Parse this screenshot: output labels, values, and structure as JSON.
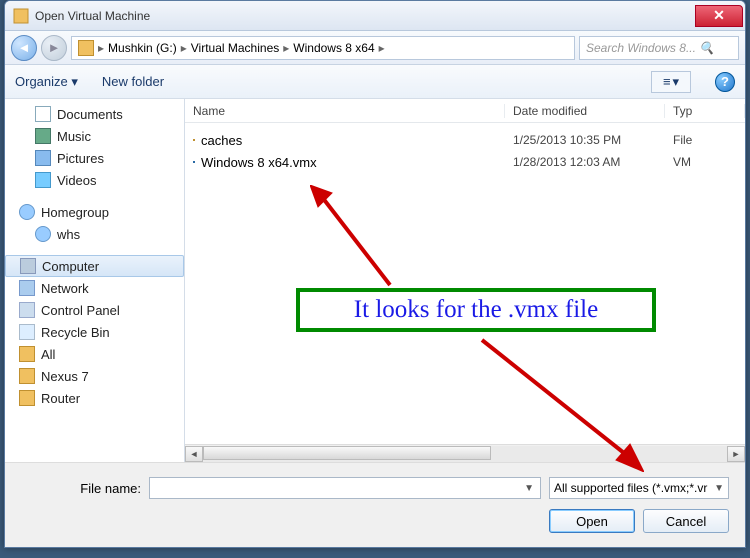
{
  "title": "Open Virtual Machine",
  "breadcrumb": {
    "drive": "Mushkin (G:)",
    "folder1": "Virtual Machines",
    "folder2": "Windows 8 x64"
  },
  "search": {
    "placeholder": "Search Windows 8..."
  },
  "cmdbar": {
    "organize": "Organize",
    "newfolder": "New folder"
  },
  "tree": {
    "documents": "Documents",
    "music": "Music",
    "pictures": "Pictures",
    "videos": "Videos",
    "homegroup": "Homegroup",
    "whs": "whs",
    "computer": "Computer",
    "network": "Network",
    "controlpanel": "Control Panel",
    "recyclebin": "Recycle Bin",
    "all": "All",
    "nexus7": "Nexus 7",
    "router": "Router"
  },
  "cols": {
    "name": "Name",
    "date": "Date modified",
    "type": "Typ"
  },
  "files": [
    {
      "name": "caches",
      "date": "1/25/2013 10:35 PM",
      "type": "File"
    },
    {
      "name": "Windows 8 x64.vmx",
      "date": "1/28/2013 12:03 AM",
      "type": "VM"
    }
  ],
  "bottom": {
    "filename_label": "File name:",
    "filename_value": "",
    "filter": "All supported files (*.vmx;*.vr",
    "open": "Open",
    "cancel": "Cancel"
  },
  "annotation": "It looks for the .vmx file"
}
